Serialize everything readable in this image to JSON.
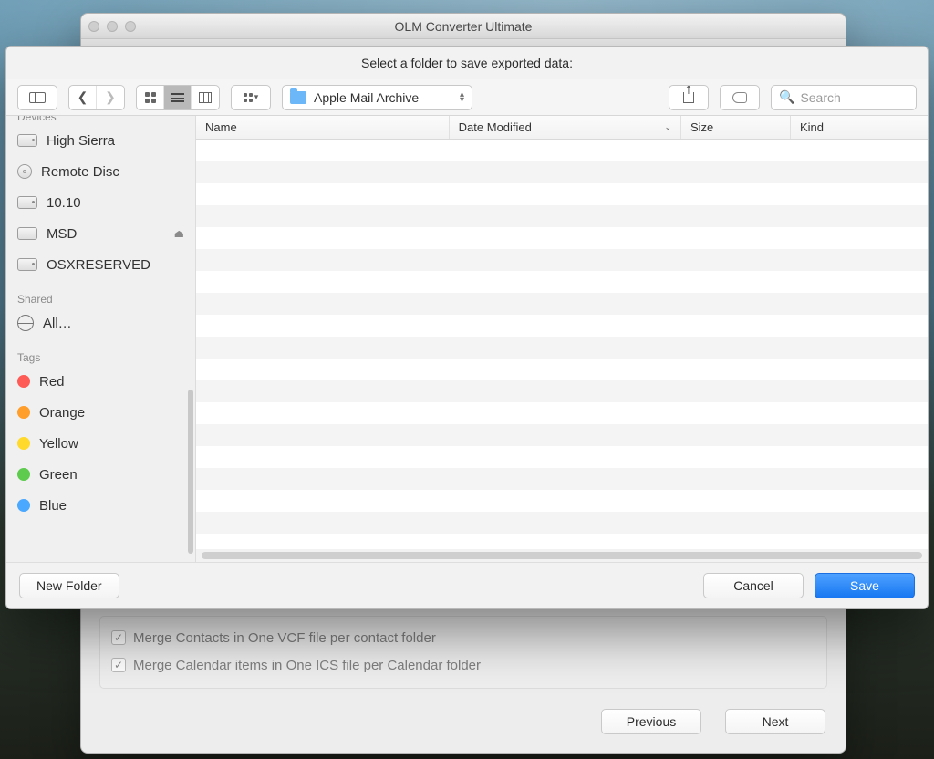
{
  "parent_window": {
    "title": "OLM Converter Ultimate",
    "bg_options": {
      "contacts": "Merge Contacts in One VCF file per contact folder",
      "calendar": "Merge Calendar items in One ICS file per Calendar folder"
    },
    "buttons": {
      "previous": "Previous",
      "next": "Next"
    }
  },
  "sheet": {
    "prompt": "Select a folder to save exported data:",
    "location": "Apple Mail Archive",
    "search_placeholder": "Search",
    "columns": {
      "name": "Name",
      "date": "Date Modified",
      "size": "Size",
      "kind": "Kind"
    },
    "buttons": {
      "new_folder": "New Folder",
      "cancel": "Cancel",
      "save": "Save"
    }
  },
  "sidebar": {
    "devices_header": "Devices",
    "devices": [
      {
        "label": "High Sierra",
        "icon": "hd",
        "eject": false
      },
      {
        "label": "Remote Disc",
        "icon": "cd",
        "eject": false
      },
      {
        "label": "10.10",
        "icon": "hd",
        "eject": false
      },
      {
        "label": "MSD",
        "icon": "ext",
        "eject": true
      },
      {
        "label": "OSXRESERVED",
        "icon": "hd",
        "eject": false
      }
    ],
    "shared_header": "Shared",
    "shared": [
      {
        "label": "All…"
      }
    ],
    "tags_header": "Tags",
    "tags": [
      {
        "label": "Red",
        "color": "#ff5b56"
      },
      {
        "label": "Orange",
        "color": "#ff9e2b"
      },
      {
        "label": "Yellow",
        "color": "#ffd92b"
      },
      {
        "label": "Green",
        "color": "#5ecb4f"
      },
      {
        "label": "Blue",
        "color": "#4aa8ff"
      }
    ]
  }
}
